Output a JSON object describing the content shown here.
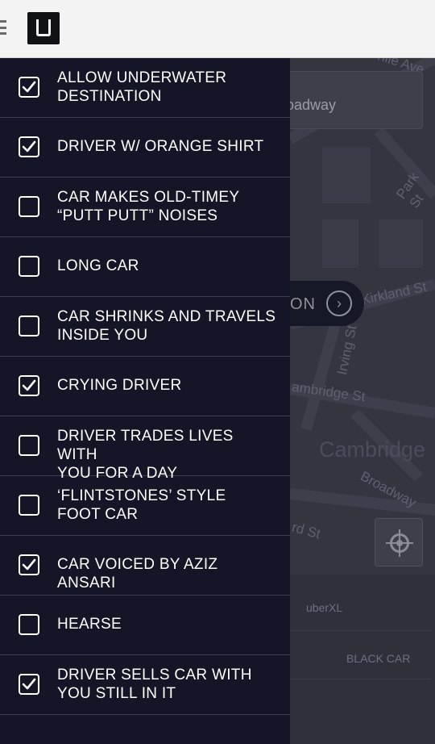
{
  "header": {
    "menu_icon": "hamburger-icon",
    "logo_icon": "uber-u-logo"
  },
  "map": {
    "destination_text": "oadway",
    "street_labels": [
      "hile Ave",
      "Park St",
      "Kirkland St",
      "Irving St",
      "ambridge St",
      "Broadway",
      "rd St"
    ],
    "city_label": "Cambridge",
    "set_button_text": "ON",
    "ride_options": [
      "uberXL",
      "BLACK CAR"
    ]
  },
  "options": [
    {
      "label": "ALLOW UNDERWATER\nDESTINATION",
      "checked": true
    },
    {
      "label": "DRIVER W/ ORANGE SHIRT",
      "checked": true
    },
    {
      "label": "CAR MAKES OLD-TIMEY\n“PUTT PUTT” NOISES",
      "checked": false
    },
    {
      "label": "LONG CAR",
      "checked": false
    },
    {
      "label": "CAR SHRINKS AND TRAVELS\nINSIDE YOU",
      "checked": false
    },
    {
      "label": "CRYING DRIVER",
      "checked": true
    },
    {
      "label": "DRIVER TRADES LIVES WITH\nYOU FOR A DAY",
      "checked": false
    },
    {
      "label": "‘FLINTSTONES’ STYLE\nFOOT CAR",
      "checked": false
    },
    {
      "label": "CAR VOICED BY AZIZ ANSARI",
      "checked": true
    },
    {
      "label": "HEARSE",
      "checked": false
    },
    {
      "label": "DRIVER SELLS CAR WITH\nYOU STILL IN IT",
      "checked": true
    }
  ],
  "colors": {
    "drawer_bg": "#141526",
    "divider": "#3b3e52",
    "text": "#ffffff",
    "map_bg": "#33353f"
  }
}
